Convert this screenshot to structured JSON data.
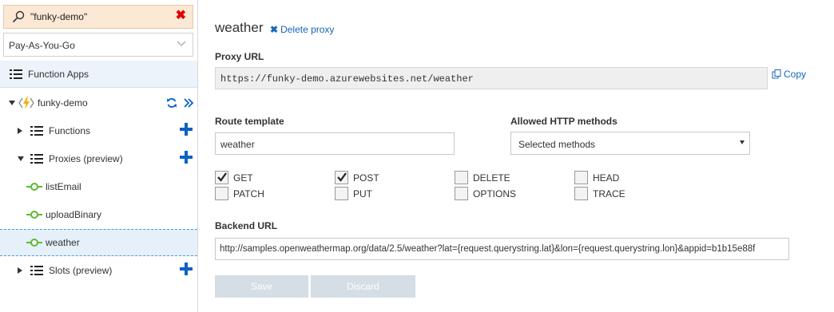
{
  "sidebar": {
    "search_value": "\"funky-demo\"",
    "subscription": "Pay-As-You-Go",
    "function_apps_label": "Function Apps",
    "app_name": "funky-demo",
    "items": [
      {
        "label": "Functions"
      },
      {
        "label": "Proxies (preview)"
      },
      {
        "label": "listEmail"
      },
      {
        "label": "uploadBinary"
      },
      {
        "label": "weather"
      },
      {
        "label": "Slots (preview)"
      }
    ]
  },
  "main": {
    "title": "weather",
    "delete_label": "Delete proxy",
    "proxy_url_label": "Proxy URL",
    "proxy_url": "https://funky-demo.azurewebsites.net/weather",
    "copy_label": "Copy",
    "route_template_label": "Route template",
    "route_template": "weather",
    "allowed_methods_label": "Allowed HTTP methods",
    "allowed_methods_value": "Selected methods",
    "methods": [
      {
        "label": "GET",
        "checked": true
      },
      {
        "label": "POST",
        "checked": true
      },
      {
        "label": "DELETE",
        "checked": false
      },
      {
        "label": "HEAD",
        "checked": false
      },
      {
        "label": "PATCH",
        "checked": false
      },
      {
        "label": "PUT",
        "checked": false
      },
      {
        "label": "OPTIONS",
        "checked": false
      },
      {
        "label": "TRACE",
        "checked": false
      }
    ],
    "backend_url_label": "Backend URL",
    "backend_url": "http://samples.openweathermap.org/data/2.5/weather?lat={request.querystring.lat}&lon={request.querystring.lon}&appid=b1b15e88f",
    "save_label": "Save",
    "discard_label": "Discard"
  },
  "colors": {
    "accent_blue": "#0b62c5",
    "link_blue": "#1565b8",
    "search_bg": "#fbe8d5",
    "clear_red": "#e00000",
    "proxy_green": "#5fb832",
    "button_disabled": "#d5dde5"
  }
}
